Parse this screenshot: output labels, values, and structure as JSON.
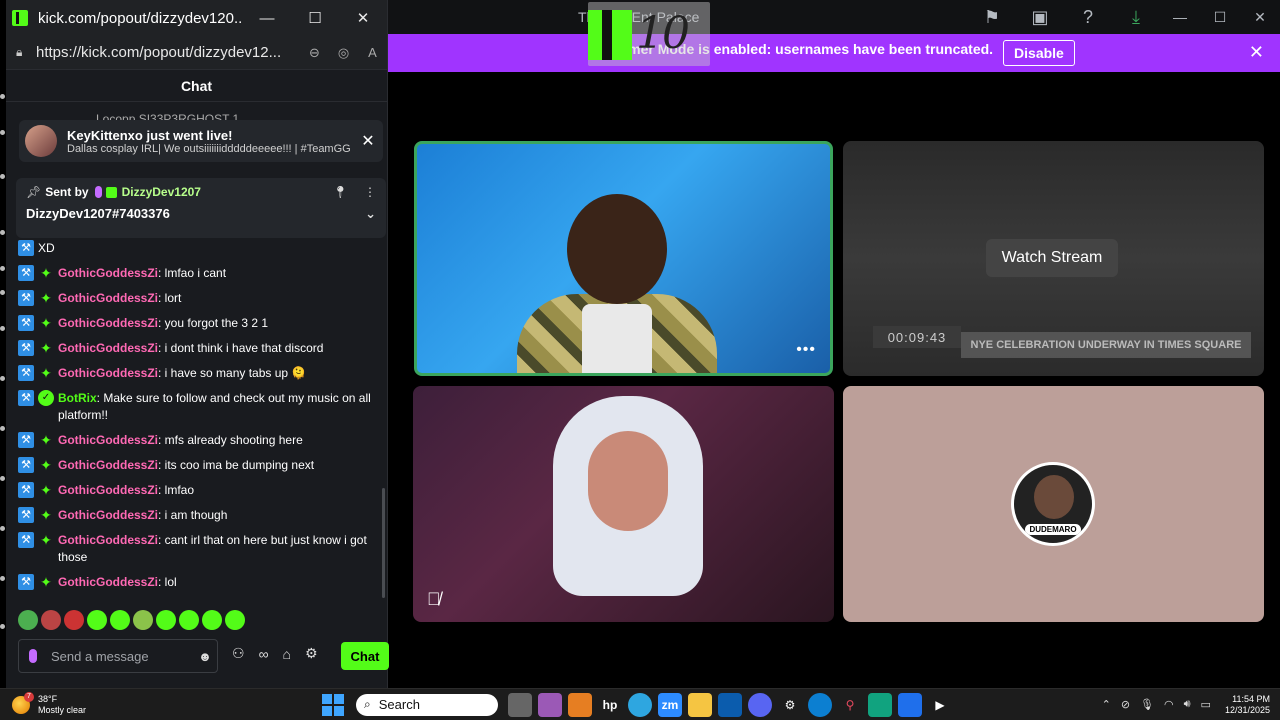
{
  "background_app": {
    "title": "The F.F. Ent Palace",
    "overlay_number": "10",
    "banner": {
      "message": "Streamer Mode is enabled: usernames have been truncated.",
      "disable_label": "Disable"
    },
    "tiles": {
      "stream": {
        "watch_label": "Watch Stream",
        "clock": "00:09:43",
        "ticker": "NYE CELEBRATION UNDERWAY IN TIMES SQUARE"
      },
      "avatar_tag": "DUDEMARO"
    }
  },
  "popout": {
    "window_title": "kick.com/popout/dizzydev120...",
    "url": "https://kick.com/popout/dizzydev12...",
    "chat_header": "Chat",
    "peek_row": "Locopp  SI33P3RGHOST  1",
    "notification": {
      "title": "KeyKittenxo just went live!",
      "subtitle": "Dallas cosplay IRL| We outsiiiiiiidddddeeeee!!! | #TeamGG |..."
    },
    "pinned": {
      "sent_by": "Sent by",
      "user": "DizzyDev1207",
      "text": "DizzyDev1207#7403376"
    },
    "messages": [
      {
        "user": "",
        "text": "XD",
        "badges": [
          "mod"
        ],
        "type": "cont"
      },
      {
        "user": "GothicGoddessZi",
        "text": ": lmfao i cant",
        "badges": [
          "mod",
          "gift"
        ],
        "type": "gg"
      },
      {
        "user": "GothicGoddessZi",
        "text": ": lort",
        "badges": [
          "mod",
          "gift"
        ],
        "type": "gg"
      },
      {
        "user": "GothicGoddessZi",
        "text": ": you forgot the 3 2 1",
        "badges": [
          "mod",
          "gift"
        ],
        "type": "gg"
      },
      {
        "user": "GothicGoddessZi",
        "text": ": i dont think i have that discord",
        "badges": [
          "mod",
          "gift"
        ],
        "type": "gg"
      },
      {
        "user": "GothicGoddessZi",
        "text": ": i have so many tabs up 🫠",
        "badges": [
          "mod",
          "gift"
        ],
        "type": "gg"
      },
      {
        "user": "BotRix",
        "text": ": Make sure to follow and check out my music on all platform!!",
        "badges": [
          "mod",
          "verified"
        ],
        "type": "bot"
      },
      {
        "user": "GothicGoddessZi",
        "text": ": mfs already shooting here",
        "badges": [
          "mod",
          "gift"
        ],
        "type": "gg"
      },
      {
        "user": "GothicGoddessZi",
        "text": ": its coo ima be dumping next",
        "badges": [
          "mod",
          "gift"
        ],
        "type": "gg"
      },
      {
        "user": "GothicGoddessZi",
        "text": ": lmfao",
        "badges": [
          "mod",
          "gift"
        ],
        "type": "gg"
      },
      {
        "user": "GothicGoddessZi",
        "text": ": i am though",
        "badges": [
          "mod",
          "gift"
        ],
        "type": "gg"
      },
      {
        "user": "GothicGoddessZi",
        "text": ": cant irl that on here but just know i got those",
        "badges": [
          "mod",
          "gift"
        ],
        "type": "gg"
      },
      {
        "user": "GothicGoddessZi",
        "text": ": lol",
        "badges": [
          "mod",
          "gift"
        ],
        "type": "gg"
      }
    ],
    "composer": {
      "placeholder": "Send a message",
      "send_label": "Chat"
    }
  },
  "taskbar": {
    "temperature": "38°F",
    "condition": "Mostly clear",
    "search_label": "Search",
    "time": "11:54 PM",
    "date": "12/31/2025"
  },
  "colors": {
    "kick_green": "#53fc18",
    "banner_purple": "#a034ff",
    "username_pink": "#ff69b4",
    "speaking_border": "#3ba55d"
  }
}
